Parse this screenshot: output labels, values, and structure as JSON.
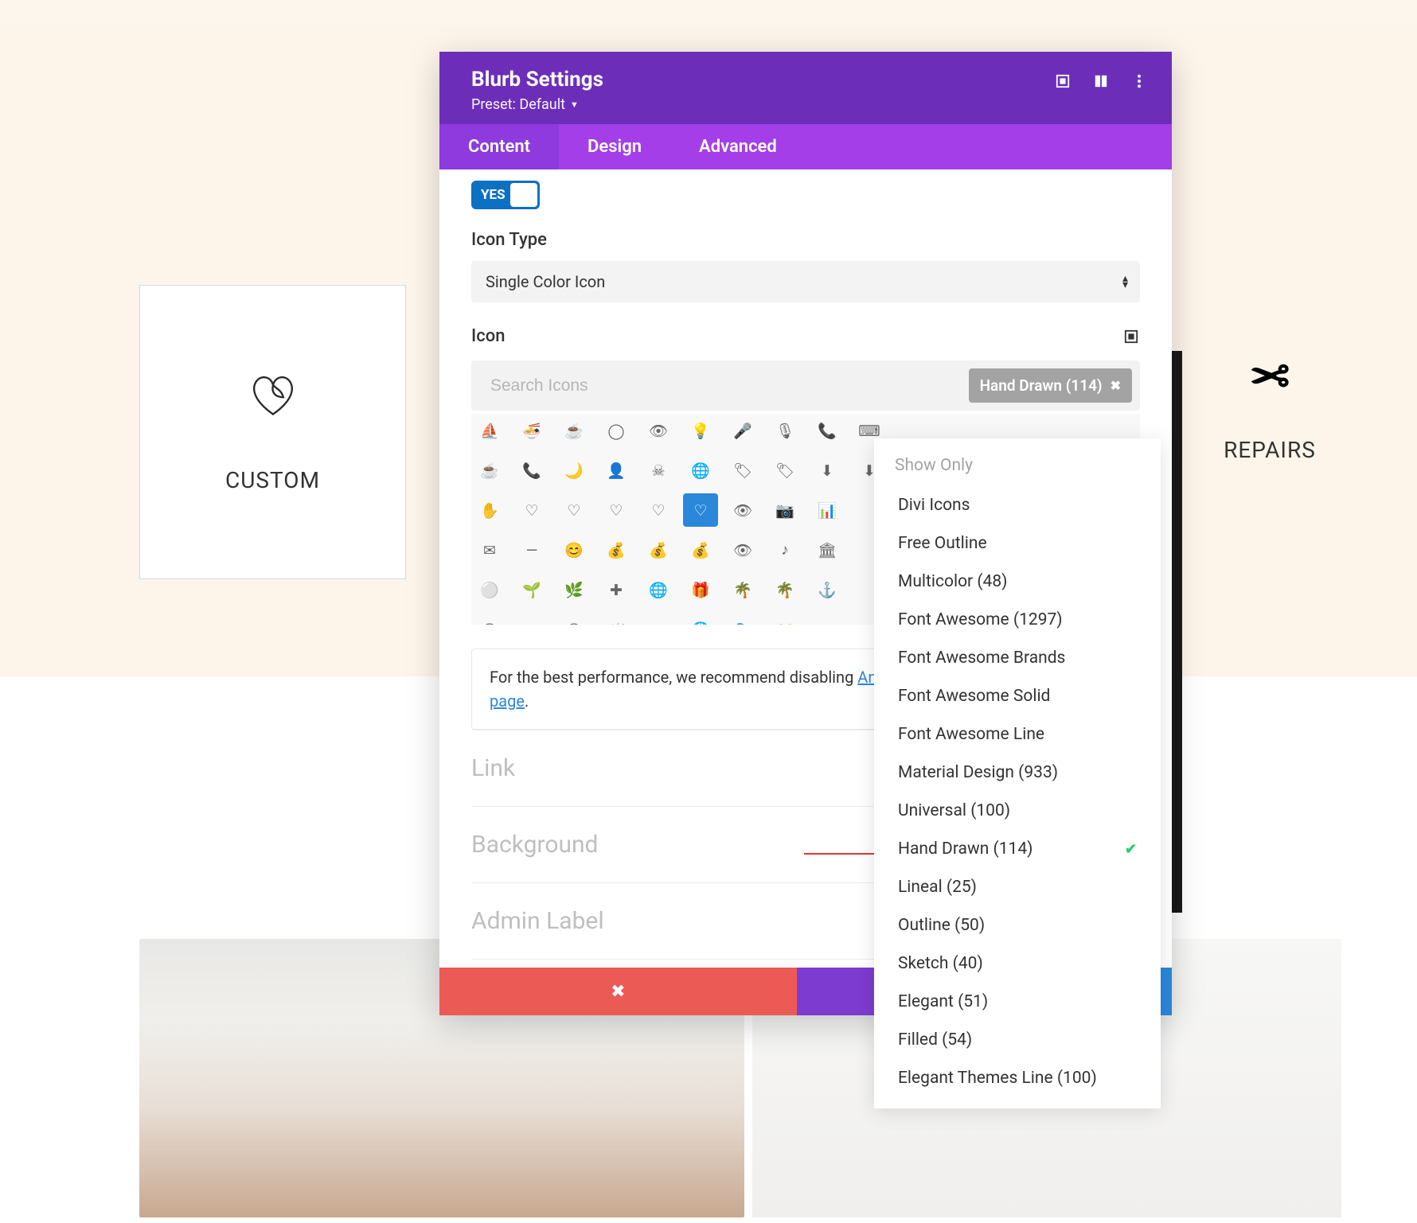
{
  "background_cards": {
    "left_label": "CUSTOM",
    "right_label": "REPAIRS"
  },
  "modal": {
    "title": "Blurb Settings",
    "preset_label": "Preset: Default",
    "tabs": {
      "content": "Content",
      "design": "Design",
      "advanced": "Advanced"
    },
    "toggle_yes": "YES",
    "icon_type_label": "Icon Type",
    "icon_type_value": "Single Color Icon",
    "icon_label": "Icon",
    "search_placeholder": "Search Icons",
    "filter_chip": "Hand Drawn (114)",
    "perf_note_prefix": "For the best performance, we recommend disabling",
    "perf_note_link": "And Divi Icons Pro plugin settings page",
    "perf_note_suffix": ".",
    "sections": {
      "link": "Link",
      "background": "Background",
      "admin_label": "Admin Label"
    }
  },
  "dropdown": {
    "header": "Show Only",
    "items": [
      "Divi Icons",
      "Free Outline",
      "Multicolor (48)",
      "Font Awesome (1297)",
      "Font Awesome Brands",
      "Font Awesome Solid",
      "Font Awesome Line",
      "Material Design (933)",
      "Universal (100)",
      "Hand Drawn (114)",
      "Lineal (25)",
      "Outline (50)",
      "Sketch (40)",
      "Elegant (51)",
      "Filled (54)",
      "Elegant Themes Line (100)"
    ],
    "selected_index": 9
  },
  "icon_glyphs": [
    [
      "⛵",
      "🍜",
      "☕",
      "◯",
      "👁",
      "💡",
      "🎤",
      "🎙",
      "📞",
      "⌨"
    ],
    [
      "☕",
      "📞",
      "🌙",
      "👤",
      "☠",
      "🌐",
      "🏷",
      "🏷",
      "⬇",
      "⬇"
    ],
    [
      "✋",
      "♡",
      "♡",
      "♡",
      "♡",
      "♡",
      "👁",
      "📷",
      "📊"
    ],
    [
      "✉",
      "—",
      "😊",
      "💰",
      "💰",
      "💰",
      "👁",
      "♪",
      "🏛"
    ],
    [
      "⚪",
      "🌱",
      "🌿",
      "✚",
      "🌐",
      "🎁",
      "🌴",
      "🌴",
      "⚓"
    ],
    [
      "◯",
      "◐",
      "◯",
      "🦋",
      "◇",
      "🌐",
      "🎭",
      "📁",
      "⬚"
    ]
  ]
}
